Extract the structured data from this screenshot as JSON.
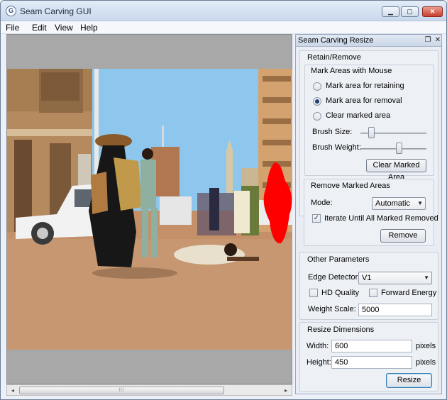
{
  "window": {
    "title": "Seam Carving GUI",
    "icon": "app-logo-icon",
    "controls": {
      "minimize": "minimize-icon",
      "maximize": "maximize-icon",
      "close": "close-icon"
    }
  },
  "menu": [
    "File",
    "Edit",
    "View",
    "Help"
  ],
  "scrollbar": {
    "left_icon": "◂",
    "right_icon": "▸",
    "grip": "⁝⁝⁝"
  },
  "panel": {
    "title": "Seam Carving Resize",
    "title_icons": [
      "float-icon",
      "close-icon"
    ],
    "retain_remove": {
      "title": "Retain/Remove",
      "mark_group_title": "Mark Areas with Mouse",
      "options": [
        {
          "label": "Mark area for retaining",
          "checked": false
        },
        {
          "label": "Mark area for removal",
          "checked": true
        },
        {
          "label": "Clear marked area",
          "checked": false
        }
      ],
      "brush_size_label": "Brush Size:",
      "brush_size_level": 0.12,
      "brush_weight_label": "Brush Weight:",
      "brush_weight_level": 0.6,
      "clear_button": "Clear Marked Area"
    },
    "remove_marked": {
      "title": "Remove Marked Areas",
      "mode_label": "Mode:",
      "mode_value": "Automatic",
      "iterate_label": "Iterate Until All Marked Removed",
      "iterate_checked": true,
      "remove_button": "Remove"
    },
    "other_params": {
      "title": "Other Parameters",
      "edge_label": "Edge Detector:",
      "edge_value": "V1",
      "hd_label": "HD Quality",
      "hd_checked": false,
      "forward_label": "Forward Energy",
      "forward_checked": false,
      "weight_label": "Weight Scale:",
      "weight_value": "5000"
    },
    "resize": {
      "title": "Resize Dimensions",
      "width_label": "Width:",
      "width_value": "600",
      "height_label": "Height:",
      "height_value": "450",
      "unit": "pixels",
      "resize_button": "Resize"
    }
  },
  "colors": {
    "removal_mark": "#ff0000",
    "sky": "#8ec7ee",
    "ground": "#c4906a"
  }
}
